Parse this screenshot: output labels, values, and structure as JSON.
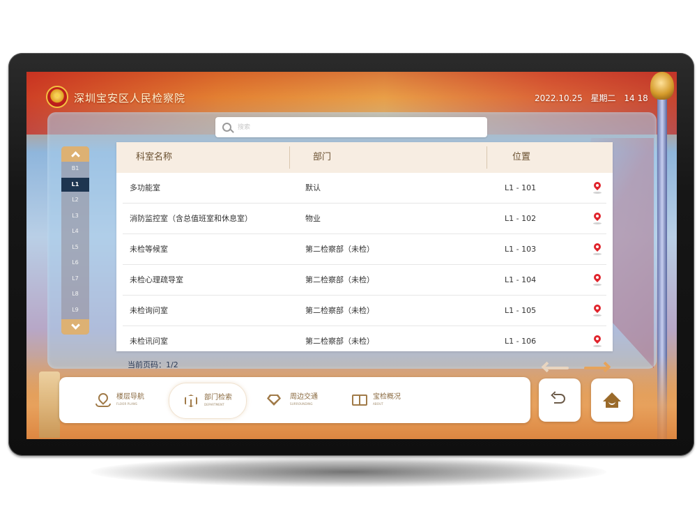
{
  "header": {
    "title": "深圳宝安区人民检察院",
    "date": "2022.10.25",
    "weekday": "星期二",
    "time": "14 18"
  },
  "search": {
    "placeholder": "搜索",
    "value": ""
  },
  "floors": {
    "items": [
      "B1",
      "L1",
      "L2",
      "L3",
      "L4",
      "L5",
      "L6",
      "L7",
      "L8",
      "L9"
    ],
    "selected": "L1"
  },
  "table": {
    "columns": [
      "科室名称",
      "部门",
      "位置"
    ],
    "rows": [
      {
        "name": "多功能室",
        "dept": "默认",
        "loc": "L1 - 101"
      },
      {
        "name": "消防监控室（含总值班室和休息室）",
        "dept": "物业",
        "loc": "L1 - 102"
      },
      {
        "name": "未检等候室",
        "dept": "第二检察部（未检）",
        "loc": "L1 - 103"
      },
      {
        "name": "未检心理疏导室",
        "dept": "第二检察部（未检）",
        "loc": "L1 - 104"
      },
      {
        "name": "未检询问室",
        "dept": "第二检察部（未检）",
        "loc": "L1 - 105"
      },
      {
        "name": "未检讯问室",
        "dept": "第二检察部（未检）",
        "loc": "L1 - 106"
      }
    ]
  },
  "pagination": {
    "label": "当前页码：1/2"
  },
  "nav": {
    "items": [
      {
        "cn": "楼层导航",
        "en": "FLOOR PLANS",
        "icon": "map-pin-icon"
      },
      {
        "cn": "部门检索",
        "en": "DEPARTMENT",
        "icon": "cube-icon"
      },
      {
        "cn": "周边交通",
        "en": "SURROUNDING",
        "icon": "diamond-icon"
      },
      {
        "cn": "宝检概况",
        "en": "ABOUT",
        "icon": "book-icon"
      }
    ],
    "active": "部门检索"
  },
  "colors": {
    "accent": "#ddb173",
    "brand_text": "#8a6a40",
    "pin": "#e0242c",
    "floor_active": "#1d3550"
  }
}
